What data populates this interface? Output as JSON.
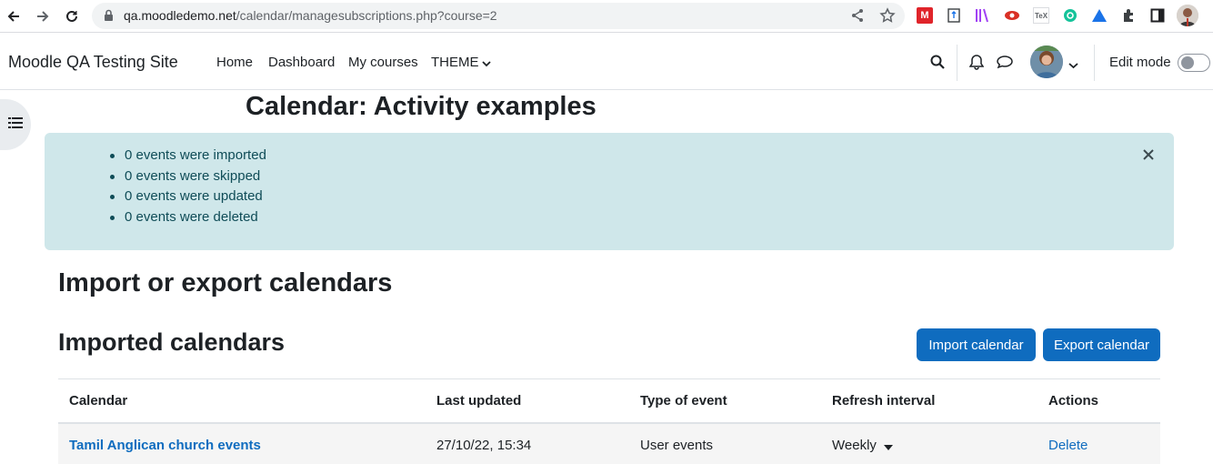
{
  "browser": {
    "url_host": "qa.moodledemo.net",
    "url_path": "/calendar/managesubscriptions.php?course=2"
  },
  "navbar": {
    "site_name": "Moodle QA Testing Site",
    "links": [
      "Home",
      "Dashboard",
      "My courses",
      "THEME"
    ],
    "edit_mode_label": "Edit mode",
    "edit_mode_on": false
  },
  "page": {
    "title": "Calendar: Activity examples"
  },
  "alert": {
    "messages": [
      "0 events were imported",
      "0 events were skipped",
      "0 events were updated",
      "0 events were deleted"
    ]
  },
  "section": {
    "heading": "Import or export calendars",
    "subheading": "Imported calendars",
    "import_button": "Import calendar",
    "export_button": "Export calendar"
  },
  "table": {
    "columns": [
      "Calendar",
      "Last updated",
      "Type of event",
      "Refresh interval",
      "Actions"
    ],
    "rows": [
      {
        "calendar": "Tamil Anglican church events",
        "last_updated": "27/10/22, 15:34",
        "type_of_event": "User events",
        "refresh_interval": "Weekly",
        "action": "Delete"
      }
    ]
  },
  "colors": {
    "primary": "#0f6cbf",
    "alert_bg": "#cfe7ea",
    "alert_text": "#0f4c57",
    "text": "#1d2125"
  }
}
